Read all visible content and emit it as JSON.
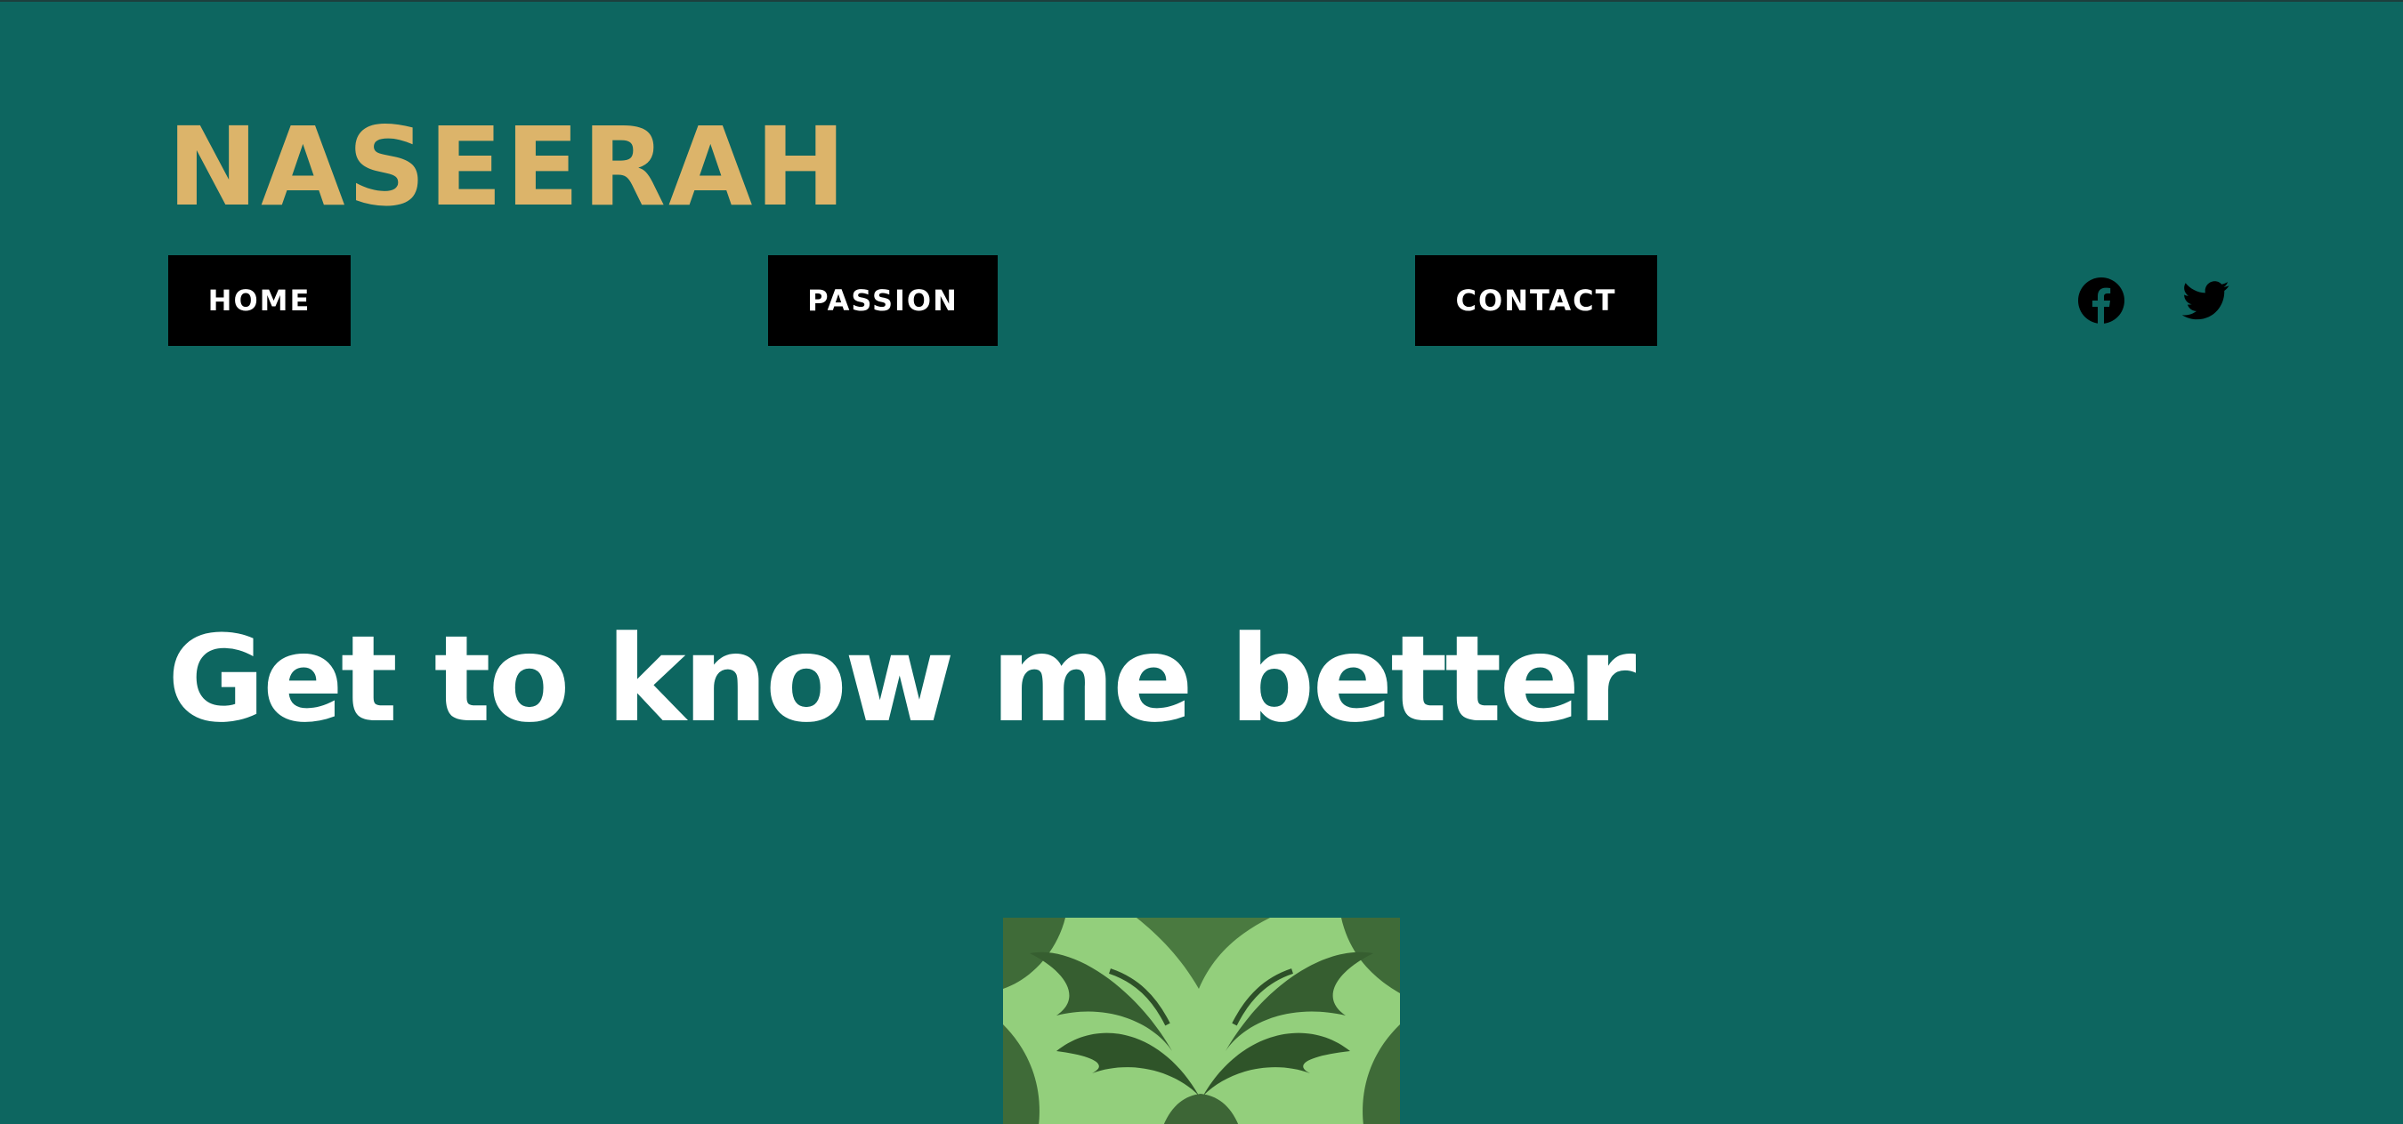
{
  "header": {
    "site_title": "NASEERAH",
    "title_color": "#dcb46a"
  },
  "nav": {
    "items": [
      {
        "label": "HOME"
      },
      {
        "label": "PASSION"
      },
      {
        "label": "CONTACT"
      }
    ]
  },
  "social": {
    "icons": [
      "facebook-icon",
      "twitter-icon"
    ]
  },
  "hero": {
    "heading": "Get to know me better",
    "image_subject": "matcha latte art"
  },
  "colors": {
    "background": "#0d6660",
    "button_bg": "#000000",
    "button_text": "#ffffff",
    "heading_text": "#ffffff"
  }
}
